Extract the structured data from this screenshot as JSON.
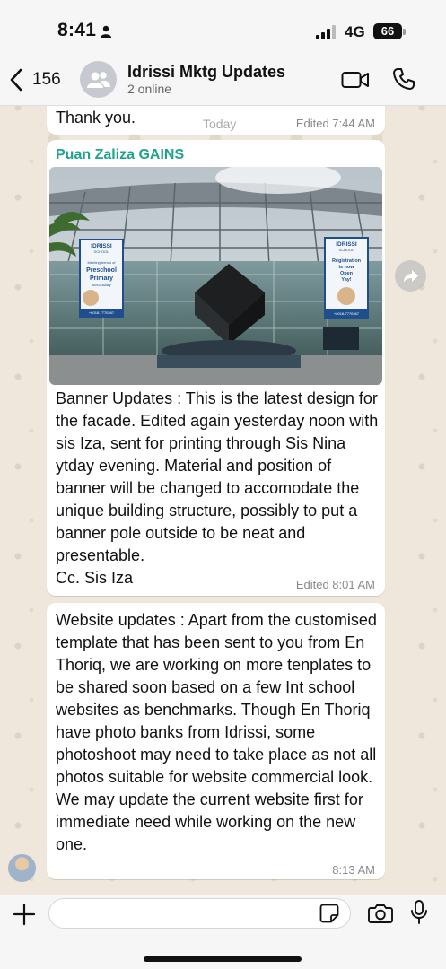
{
  "status_bar": {
    "time": "8:41",
    "network": "4G",
    "battery": "66"
  },
  "header": {
    "back_count": "156",
    "group_name": "Idrissi Mktg Updates",
    "subtitle": "2 online",
    "icons": {
      "back": "chevron-left-icon",
      "avatar": "group-avatar-icon",
      "video": "video-call-icon",
      "phone": "phone-call-icon"
    }
  },
  "chat": {
    "date_label": "Today",
    "messages": [
      {
        "text": "Thank you.",
        "meta": "Edited 7:44 AM"
      },
      {
        "sender": "Puan Zaliza GAINS",
        "image": {
          "kind": "building-facade-photo",
          "banner_left": {
            "brand": "IDRISSI",
            "brand_sub": "SCHOOL",
            "headline": "Meeting trends of",
            "line_big_1": "Preschool",
            "line_big_2": "Primary",
            "line_small": "Secondary",
            "phone": "+6018-7770367"
          },
          "banner_right": {
            "brand": "IDRISSI",
            "brand_sub": "SCHOOL",
            "headline_1": "Registration",
            "headline_2": "is now",
            "headline_3": "Open",
            "headline_4": "Yay!",
            "phone": "+6018-7770367"
          }
        },
        "text": "Banner Updates : This is the latest design for the facade.  Edited again yesterday noon with sis Iza, sent for printing through Sis Nina ytday evening. Material and position of banner will be changed to accomodate the unique building structure, possibly to put a banner pole outside to be neat and presentable.\nCc. Sis Iza",
        "meta": "Edited 8:01 AM"
      },
      {
        "text": "Website updates : Apart from the customised template that has been sent to you from En Thoriq, we are working on more tenplates to be shared soon based on a few Int school websites as benchmarks. Though En Thoriq have photo banks from Idrissi, some photoshoot may need to take place as not all photos suitable for website commercial look. We may update the current website first for immediate need while working on the new one.",
        "meta": "8:13 AM"
      }
    ]
  },
  "input_bar": {
    "placeholder": "",
    "icons": {
      "plus": "plus-icon",
      "sticker": "sticker-icon",
      "camera": "camera-icon",
      "mic": "microphone-icon"
    }
  },
  "colors": {
    "sender_name": "#1fa38a",
    "bubble": "#ffffff",
    "wallpaper": "#efe7dc"
  }
}
